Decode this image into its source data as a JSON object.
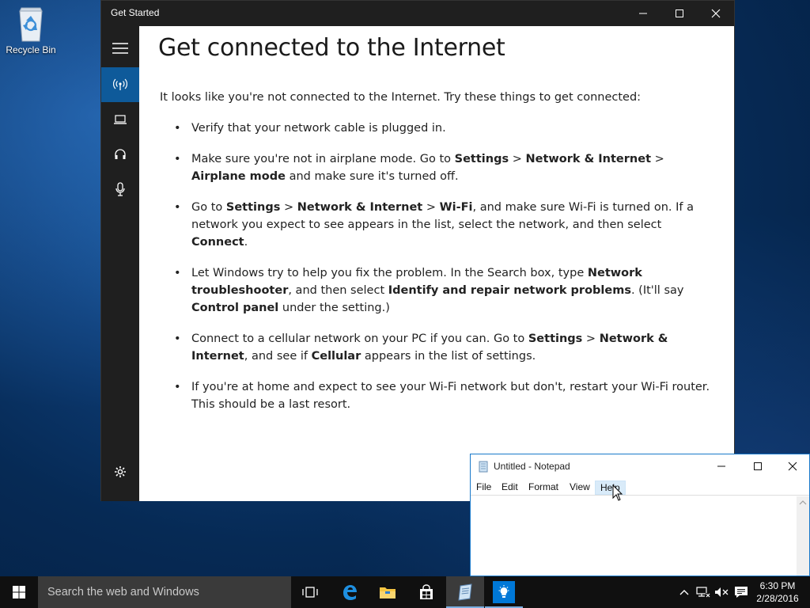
{
  "desktop": {
    "icons": [
      {
        "label": "Recycle Bin",
        "icon": "recycle-bin-icon"
      }
    ]
  },
  "get_started": {
    "title": "Get Started",
    "controls": [
      "minimize-icon",
      "maximize-icon",
      "close-icon"
    ],
    "sidebar": [
      {
        "icon": "hamburger-menu-icon",
        "active": false
      },
      {
        "icon": "wireless-signal-icon",
        "active": true
      },
      {
        "icon": "laptop-icon",
        "active": false
      },
      {
        "icon": "headphones-icon",
        "active": false
      },
      {
        "icon": "microphone-icon",
        "active": false
      },
      {
        "icon": "gear-icon",
        "active": false
      }
    ],
    "heading": "Get connected to the Internet",
    "intro": "It looks like you're not connected to the Internet. Try these things to get connected:",
    "bullet_char": "•",
    "items": [
      {
        "t0": "Verify that your network cable is plugged in."
      },
      {
        "t0": "Make sure you're not in airplane mode. Go to ",
        "b0": "Settings",
        "t1": " > ",
        "b1": "Network & Internet",
        "t2": " > ",
        "b2": "Airplane mode",
        "t3": " and make sure it's turned off."
      },
      {
        "t0": "Go to ",
        "b0": "Settings",
        "t1": " > ",
        "b1": "Network & Internet",
        "t2": " > ",
        "b2": "Wi-Fi",
        "t3": ", and make sure Wi-Fi is turned on. If a network you expect to see appears in the list, select the network, and then select ",
        "b3": "Connect",
        "t4": "."
      },
      {
        "t0": "Let Windows try to help you fix the problem. In the Search box, type ",
        "b0": "Network troubleshooter",
        "t1": ", and then select ",
        "b1": "Identify and repair network problems",
        "t2": ". (It'll say ",
        "b2": "Control panel",
        "t3": " under the setting.)"
      },
      {
        "t0": "Connect to a cellular network on your PC if you can. Go to ",
        "b0": "Settings",
        "t1": " > ",
        "b1": "Network & Internet",
        "t2": ", and see if ",
        "b2": "Cellular",
        "t3": " appears in the list of settings."
      },
      {
        "t0": "If you're at home and expect to see your Wi-Fi network but don't, restart your Wi-Fi router. This should be a last resort."
      }
    ]
  },
  "notepad": {
    "title": "Untitled - Notepad",
    "menu": [
      "File",
      "Edit",
      "Format",
      "View",
      "Help"
    ],
    "hovered_menu": "Help",
    "text": ""
  },
  "taskbar": {
    "search_placeholder": "Search the web and Windows",
    "items": [
      "task-view-icon",
      "edge-icon",
      "file-explorer-icon",
      "store-icon",
      "notepad-icon",
      "tips-icon"
    ],
    "tray": [
      "show-hidden-icons-icon",
      "network-disconnected-icon",
      "volume-muted-icon",
      "action-center-icon"
    ],
    "time": "6:30 PM",
    "date": "2/28/2016"
  },
  "colors": {
    "accent": "#0e5a9a",
    "titlebar": "#1f1f1f",
    "taskbar": "#101010",
    "tips_tile": "#0078d7"
  }
}
